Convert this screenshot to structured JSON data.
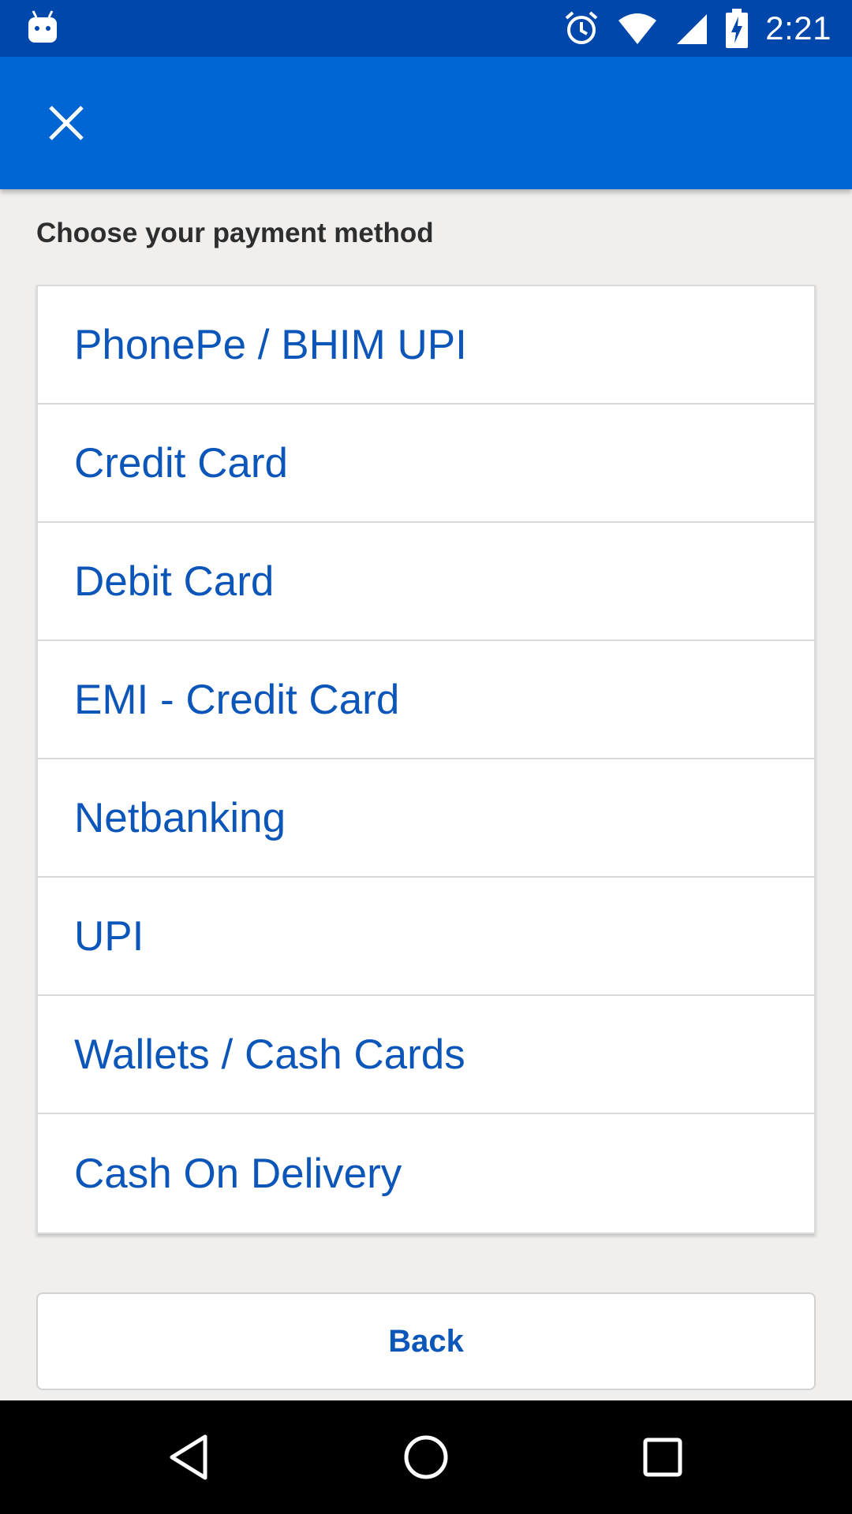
{
  "status_bar": {
    "time": "2:21",
    "icons": [
      "android-notification-icon",
      "alarm-icon",
      "wifi-icon",
      "cell-signal-icon",
      "battery-charging-icon"
    ]
  },
  "app_bar": {
    "close_icon": "close-icon"
  },
  "heading": "Choose your payment method",
  "payment_methods": [
    {
      "label": "PhonePe / BHIM UPI"
    },
    {
      "label": "Credit Card"
    },
    {
      "label": "Debit Card"
    },
    {
      "label": "EMI - Credit Card"
    },
    {
      "label": "Netbanking"
    },
    {
      "label": "UPI"
    },
    {
      "label": "Wallets / Cash Cards"
    },
    {
      "label": "Cash On Delivery"
    }
  ],
  "back_label": "Back",
  "nav_bar": {
    "icons": [
      "back-triangle-icon",
      "home-circle-icon",
      "recents-square-icon"
    ]
  },
  "colors": {
    "status_bar": "#0047ab",
    "app_bar": "#0066d4",
    "link_text": "#0b56b8",
    "background": "#f0efee"
  }
}
